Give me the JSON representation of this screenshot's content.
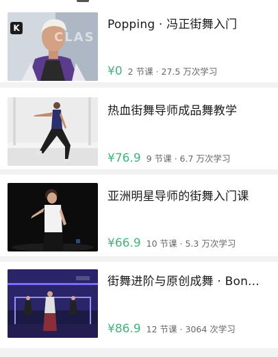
{
  "courses": [
    {
      "title": "Popping · 冯正街舞入门",
      "price": "¥0",
      "meta": "2 节课 · 27.5 万次学习",
      "thumb_text": "CLAS",
      "badge": "K"
    },
    {
      "title": "热血街舞导师成品舞教学",
      "price": "¥76.9",
      "meta": "9 节课 · 6.7 万次学习"
    },
    {
      "title": "亚洲明星导师的街舞入门课",
      "price": "¥66.9",
      "meta": "10 节课 · 5.3 万次学习"
    },
    {
      "title": "街舞进阶与原创成舞 · Bon...",
      "price": "¥86.9",
      "meta": "12 节课 · 3064 次学习"
    }
  ],
  "colors": {
    "price": "#3db77a",
    "divider": "#f2f2f2"
  }
}
